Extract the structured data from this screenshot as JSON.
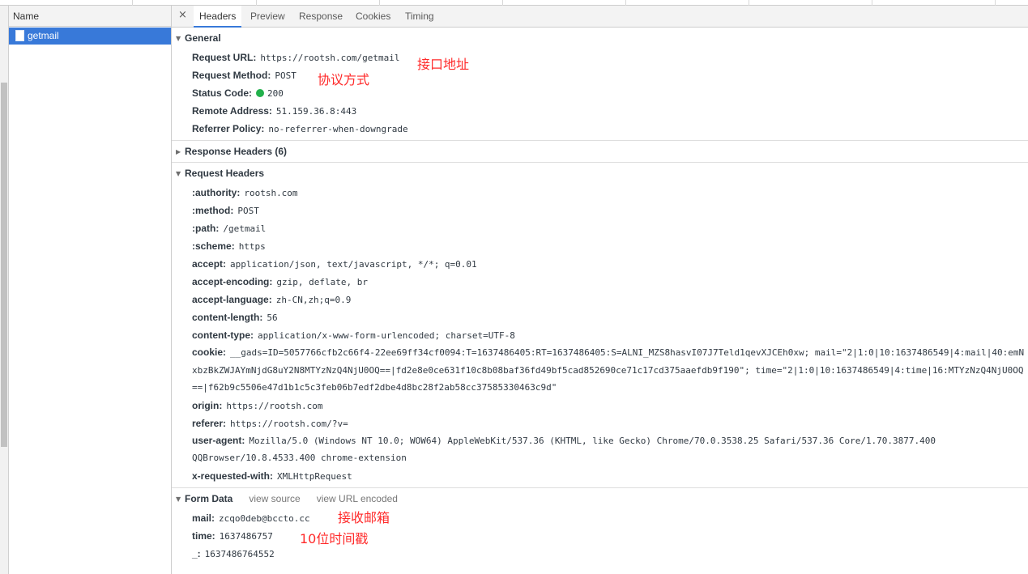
{
  "name_column": {
    "header": "Name",
    "requests": [
      "getmail"
    ]
  },
  "tabs": {
    "close_symbol": "×",
    "items": [
      "Headers",
      "Preview",
      "Response",
      "Cookies",
      "Timing"
    ],
    "active": "Headers"
  },
  "general": {
    "title": "General",
    "rows": [
      {
        "key": "Request URL:",
        "value": "https://rootsh.com/getmail"
      },
      {
        "key": "Request Method:",
        "value": "POST"
      },
      {
        "key": "Status Code:",
        "value": "200"
      },
      {
        "key": "Remote Address:",
        "value": "51.159.36.8:443"
      },
      {
        "key": "Referrer Policy:",
        "value": "no-referrer-when-downgrade"
      }
    ]
  },
  "response_headers": {
    "title": "Response Headers (6)"
  },
  "request_headers": {
    "title": "Request Headers",
    "rows": [
      {
        "key": ":authority:",
        "value": "rootsh.com"
      },
      {
        "key": ":method:",
        "value": "POST"
      },
      {
        "key": ":path:",
        "value": "/getmail"
      },
      {
        "key": ":scheme:",
        "value": "https"
      },
      {
        "key": "accept:",
        "value": "application/json, text/javascript, */*; q=0.01"
      },
      {
        "key": "accept-encoding:",
        "value": "gzip, deflate, br"
      },
      {
        "key": "accept-language:",
        "value": "zh-CN,zh;q=0.9"
      },
      {
        "key": "content-length:",
        "value": "56"
      },
      {
        "key": "content-type:",
        "value": "application/x-www-form-urlencoded; charset=UTF-8"
      },
      {
        "key": "cookie:",
        "value": "__gads=ID=5057766cfb2c66f4-22ee69ff34cf0094:T=1637486405:RT=1637486405:S=ALNI_MZS8hasvI07J7Teld1qevXJCEh0xw; mail=\"2|1:0|10:1637486549|4:mail|40:emNxbzBkZWJAYmNjdG8uY2N8MTYzNzQ4NjU0OQ==|fd2e8e0ce631f10c8b08baf36fd49bf5cad852690ce71c17cd375aaefdb9f190\"; time=\"2|1:0|10:1637486549|4:time|16:MTYzNzQ4NjU0OQ==|f62b9c5506e47d1b1c5c3feb06b7edf2dbe4d8bc28f2ab58cc37585330463c9d\""
      },
      {
        "key": "origin:",
        "value": "https://rootsh.com"
      },
      {
        "key": "referer:",
        "value": "https://rootsh.com/?v="
      },
      {
        "key": "user-agent:",
        "value": "Mozilla/5.0 (Windows NT 10.0; WOW64) AppleWebKit/537.36 (KHTML, like Gecko) Chrome/70.0.3538.25 Safari/537.36 Core/1.70.3877.400 QQBrowser/10.8.4533.400 chrome-extension"
      },
      {
        "key": "x-requested-with:",
        "value": "XMLHttpRequest"
      }
    ]
  },
  "form_data": {
    "title": "Form Data",
    "view_source": "view source",
    "view_url_encoded": "view URL encoded",
    "rows": [
      {
        "key": "mail:",
        "value": "zcqo0deb@bccto.cc"
      },
      {
        "key": "time:",
        "value": "1637486757"
      },
      {
        "key": "_:",
        "value": "1637486764552"
      }
    ]
  },
  "annotations": {
    "url": "接口地址",
    "method": "协议方式",
    "mail": "接收邮箱",
    "time": "10位时间戳"
  },
  "colors": {
    "selected_row": "#3879d9",
    "status_ok": "#22b14c",
    "annotation": "#ff2a2a"
  }
}
